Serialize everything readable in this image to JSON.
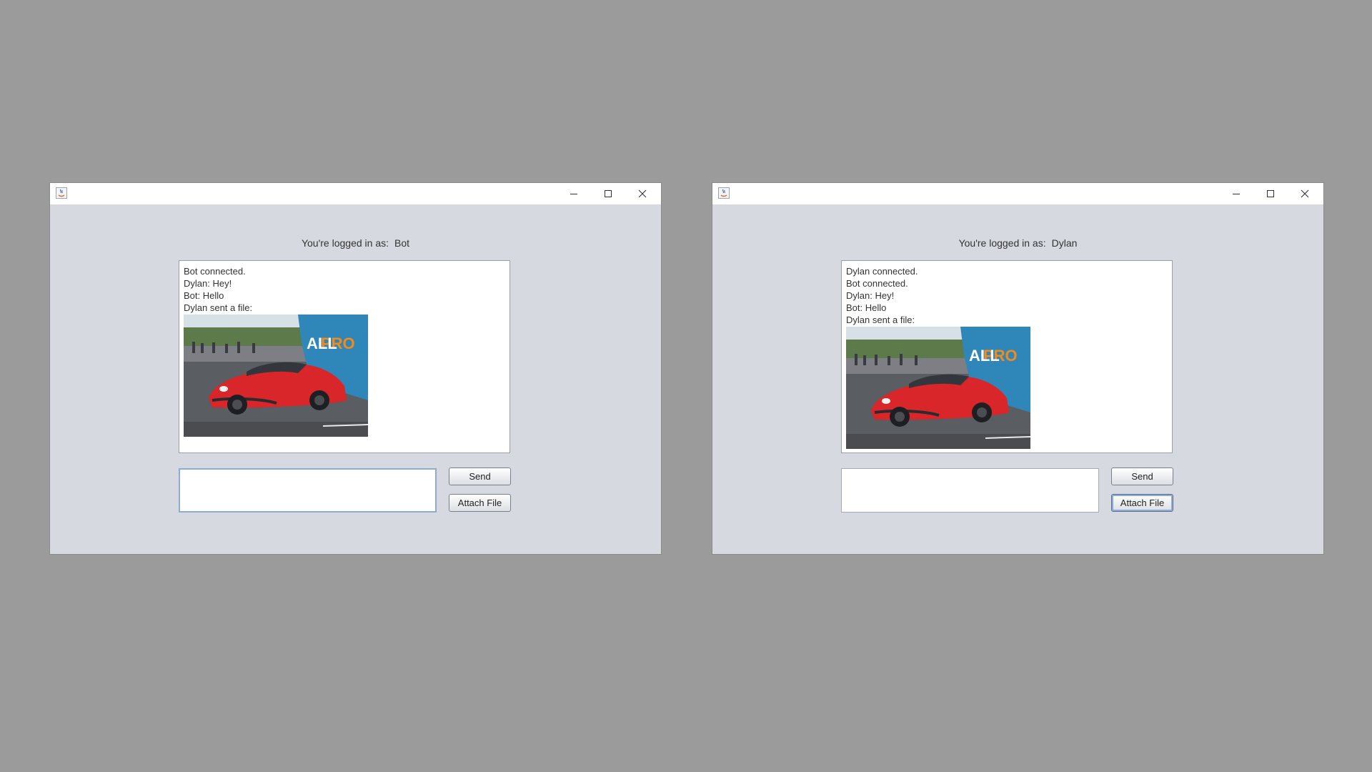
{
  "windows": [
    {
      "logged_in_label": "You're logged in as:",
      "username": "Bot",
      "messages": [
        "Bot connected.",
        "Dylan: Hey!",
        "Bot: Hello",
        "Dylan sent a file:"
      ],
      "attachment_icon": "car-photo",
      "input_value": "",
      "send_label": "Send",
      "attach_label": "Attach File"
    },
    {
      "logged_in_label": "You're logged in as:",
      "username": "Dylan",
      "messages": [
        "Dylan connected.",
        "Bot connected.",
        "Dylan: Hey!",
        "Bot: Hello",
        "Dylan sent a file:"
      ],
      "attachment_icon": "car-photo",
      "input_value": "",
      "send_label": "Send",
      "attach_label": "Attach File"
    }
  ],
  "colors": {
    "desktop": "#9b9b9b",
    "window_bg": "#d6d9df",
    "car_red": "#d8262b",
    "banner_blue": "#2f86b8",
    "banner_orange": "#f28a1c"
  }
}
